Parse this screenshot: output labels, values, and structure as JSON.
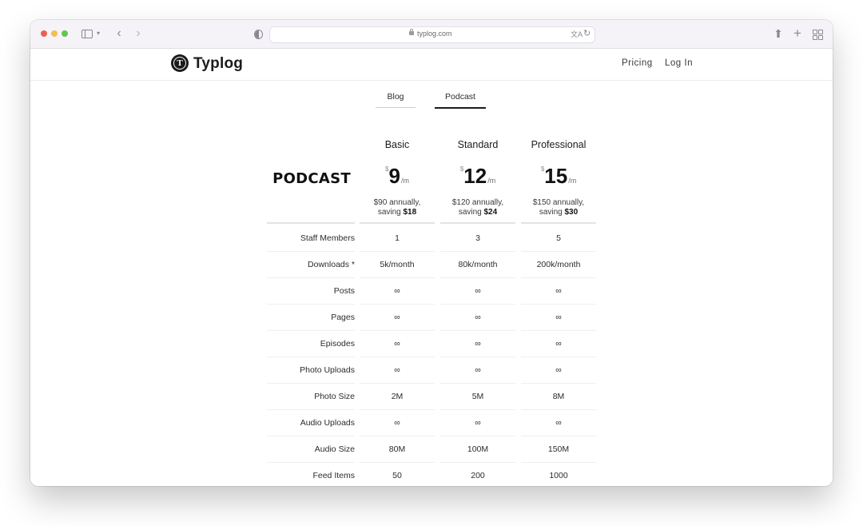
{
  "browser": {
    "url": "typlog.com"
  },
  "site": {
    "logo_text": "Typlog",
    "logo_letter": "T",
    "nav": {
      "pricing": "Pricing",
      "login": "Log In"
    }
  },
  "tabs": [
    {
      "label": "Blog",
      "active": false
    },
    {
      "label": "Podcast",
      "active": true
    }
  ],
  "pricing": {
    "section_title": "PODCAST",
    "plans": [
      {
        "name": "Basic",
        "currency": "$",
        "amount": "9",
        "period": "/m",
        "annual_text": "$90 annually,",
        "saving_prefix": "saving ",
        "saving_amount": "$18"
      },
      {
        "name": "Standard",
        "currency": "$",
        "amount": "12",
        "period": "/m",
        "annual_text": "$120 annually,",
        "saving_prefix": "saving ",
        "saving_amount": "$24"
      },
      {
        "name": "Professional",
        "currency": "$",
        "amount": "15",
        "period": "/m",
        "annual_text": "$150 annually,",
        "saving_prefix": "saving ",
        "saving_amount": "$30"
      }
    ],
    "features": [
      {
        "label": "Staff Members",
        "values": [
          "1",
          "3",
          "5"
        ]
      },
      {
        "label": "Downloads *",
        "values": [
          "5k/month",
          "80k/month",
          "200k/month"
        ]
      },
      {
        "label": "Posts",
        "values": [
          "∞",
          "∞",
          "∞"
        ]
      },
      {
        "label": "Pages",
        "values": [
          "∞",
          "∞",
          "∞"
        ]
      },
      {
        "label": "Episodes",
        "values": [
          "∞",
          "∞",
          "∞"
        ]
      },
      {
        "label": "Photo Uploads",
        "values": [
          "∞",
          "∞",
          "∞"
        ]
      },
      {
        "label": "Photo Size",
        "values": [
          "2M",
          "5M",
          "8M"
        ]
      },
      {
        "label": "Audio Uploads",
        "values": [
          "∞",
          "∞",
          "∞"
        ]
      },
      {
        "label": "Audio Size",
        "values": [
          "80M",
          "100M",
          "150M"
        ]
      },
      {
        "label": "Feed Items",
        "values": [
          "50",
          "200",
          "1000"
        ]
      }
    ]
  }
}
